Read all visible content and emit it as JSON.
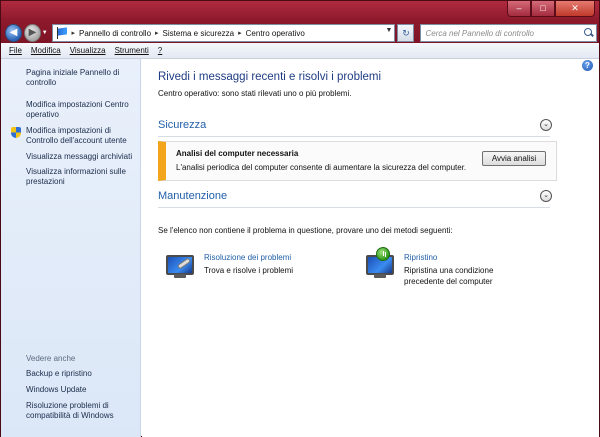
{
  "window": {
    "caption_buttons": {
      "minimize": "–",
      "maximize": "□",
      "close": "✕"
    }
  },
  "nav": {
    "back_glyph": "◀",
    "forward_glyph": "▶",
    "history_glyph": "▼",
    "breadcrumbs": [
      "Pannello di controllo",
      "Sistema e sicurezza",
      "Centro operativo"
    ],
    "breadcrumb_separator": "▸",
    "refresh_glyph": "↻",
    "search_placeholder": "Cerca nel Pannello di controllo"
  },
  "menubar": {
    "items": [
      {
        "label": "File",
        "accel": "F"
      },
      {
        "label": "Modifica",
        "accel": "M"
      },
      {
        "label": "Visualizza",
        "accel": "V"
      },
      {
        "label": "Strumenti",
        "accel": "S"
      },
      {
        "label": "?",
        "accel": "?"
      }
    ]
  },
  "sidebar": {
    "links": [
      "Pagina iniziale Pannello di controllo",
      "Modifica impostazioni Centro operativo",
      "Modifica impostazioni di Controllo dell'account utente",
      "Visualizza messaggi archiviati",
      "Visualizza informazioni sulle prestazioni"
    ],
    "see_also_heading": "Vedere anche",
    "see_also": [
      "Backup e ripristino",
      "Windows Update",
      "Risoluzione problemi di compatibilità di Windows"
    ]
  },
  "main": {
    "help_glyph": "?",
    "title": "Rivedi i messaggi recenti e risolvi i problemi",
    "subtitle": "Centro operativo: sono stati rilevati uno o più problemi.",
    "sections": [
      {
        "title": "Sicurezza",
        "chevron": "⌄"
      },
      {
        "title": "Manutenzione",
        "chevron": "⌄"
      }
    ],
    "alert": {
      "title": "Analisi del computer necessaria",
      "text": "L'analisi periodica del computer consente di aumentare la sicurezza del computer.",
      "button": "Avvia analisi"
    },
    "prompt": "Se l'elenco non contiene il problema in questione, provare uno dei metodi seguenti:",
    "tools": [
      {
        "title": "Risoluzione dei problemi",
        "desc": "Trova e risolve i problemi"
      },
      {
        "title": "Ripristino",
        "desc": "Ripristina una condizione precedente del computer"
      }
    ]
  },
  "colors": {
    "accent_link": "#2160a8",
    "title_blue": "#1f3c83",
    "alert_stripe": "#f3a51b",
    "chrome": "#8e1a2c"
  }
}
